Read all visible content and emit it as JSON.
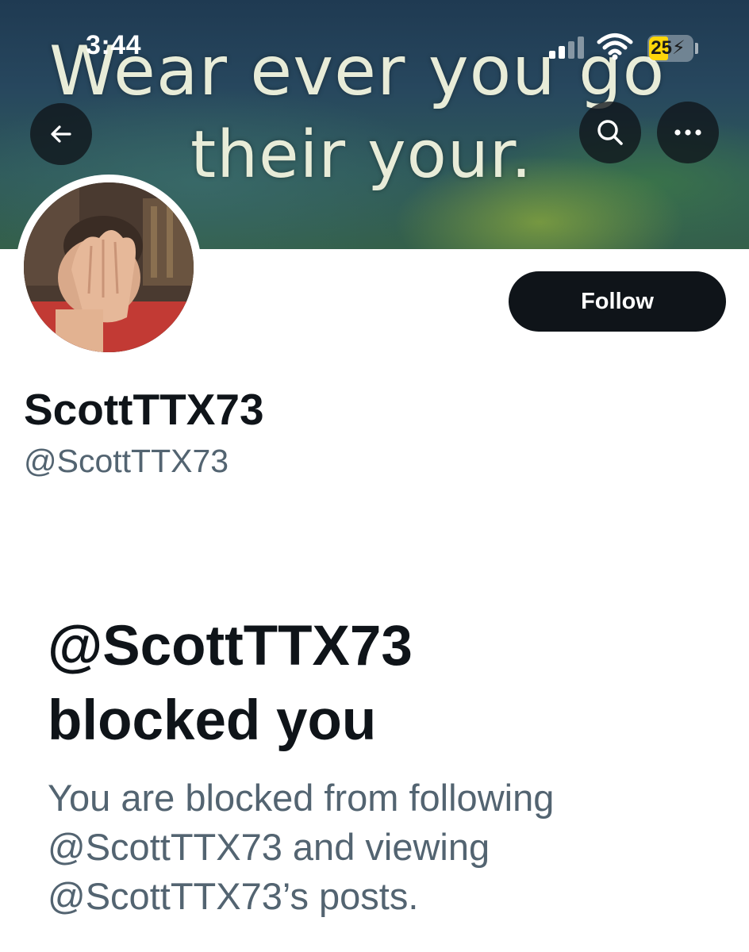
{
  "status_bar": {
    "time": "3:44",
    "battery_level": "25"
  },
  "banner": {
    "line1": "Wear ever you go",
    "line2": "their your."
  },
  "profile": {
    "display_name": "ScottTTX73",
    "handle": "@ScottTTX73",
    "follow_label": "Follow"
  },
  "blocked": {
    "title_line1": "@ScottTTX73",
    "title_line2": "blocked you",
    "desc_line1": "You are blocked from following",
    "desc_line2": "@ScottTTX73 and viewing",
    "desc_line3": "@ScottTTX73’s posts."
  },
  "icons": {
    "back": "arrow-left-icon",
    "search": "search-icon",
    "more": "more-horizontal-icon",
    "signal": "cellular-signal-icon",
    "wifi": "wifi-icon",
    "battery": "battery-charging-icon"
  },
  "colors": {
    "primary_text": "#0f1419",
    "secondary_text": "#536471",
    "follow_button": "#0f1419",
    "battery_fill": "#ffd60a"
  }
}
